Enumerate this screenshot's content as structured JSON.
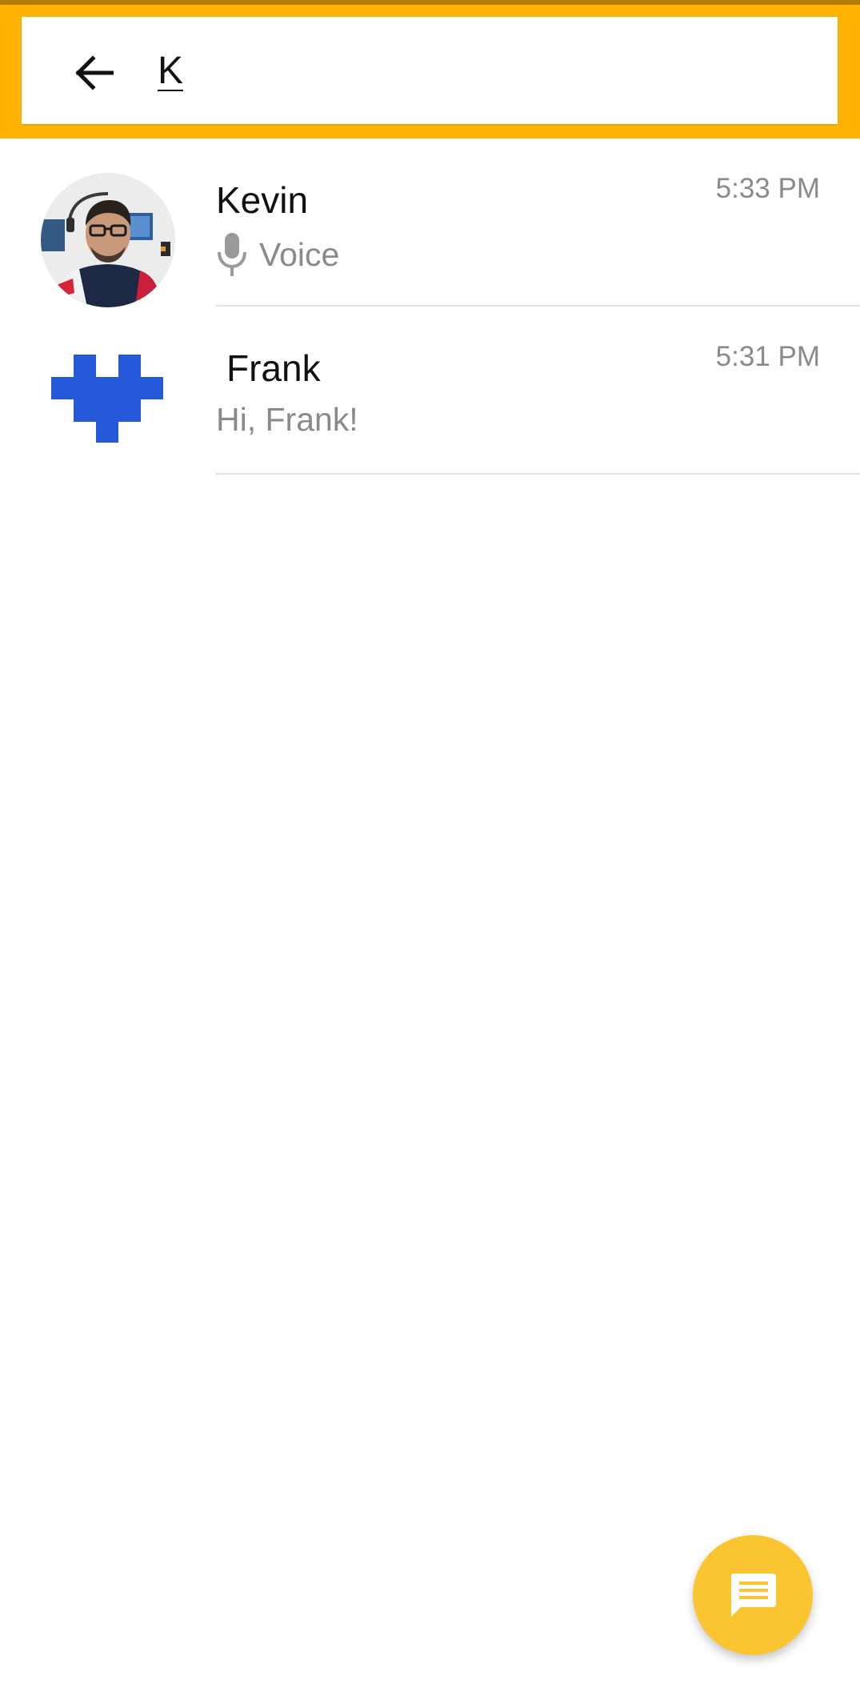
{
  "search": {
    "query": "K"
  },
  "conversations": [
    {
      "name": "Kevin",
      "time": "5:33 PM",
      "snippet": "Voice",
      "snippet_icon": "mic-icon",
      "avatar": "photo"
    },
    {
      "name": "Frank",
      "time": "5:31 PM",
      "snippet": "Hi, Frank!",
      "avatar": "blue-heart-icon"
    }
  ],
  "colors": {
    "toolbar": "#ffb300",
    "status_strip": "#b07f00",
    "fab": "#fbc531",
    "avatar_heart": "#2559d9",
    "secondary_text": "#8a8a8a"
  },
  "fab": {
    "icon": "message-icon"
  }
}
